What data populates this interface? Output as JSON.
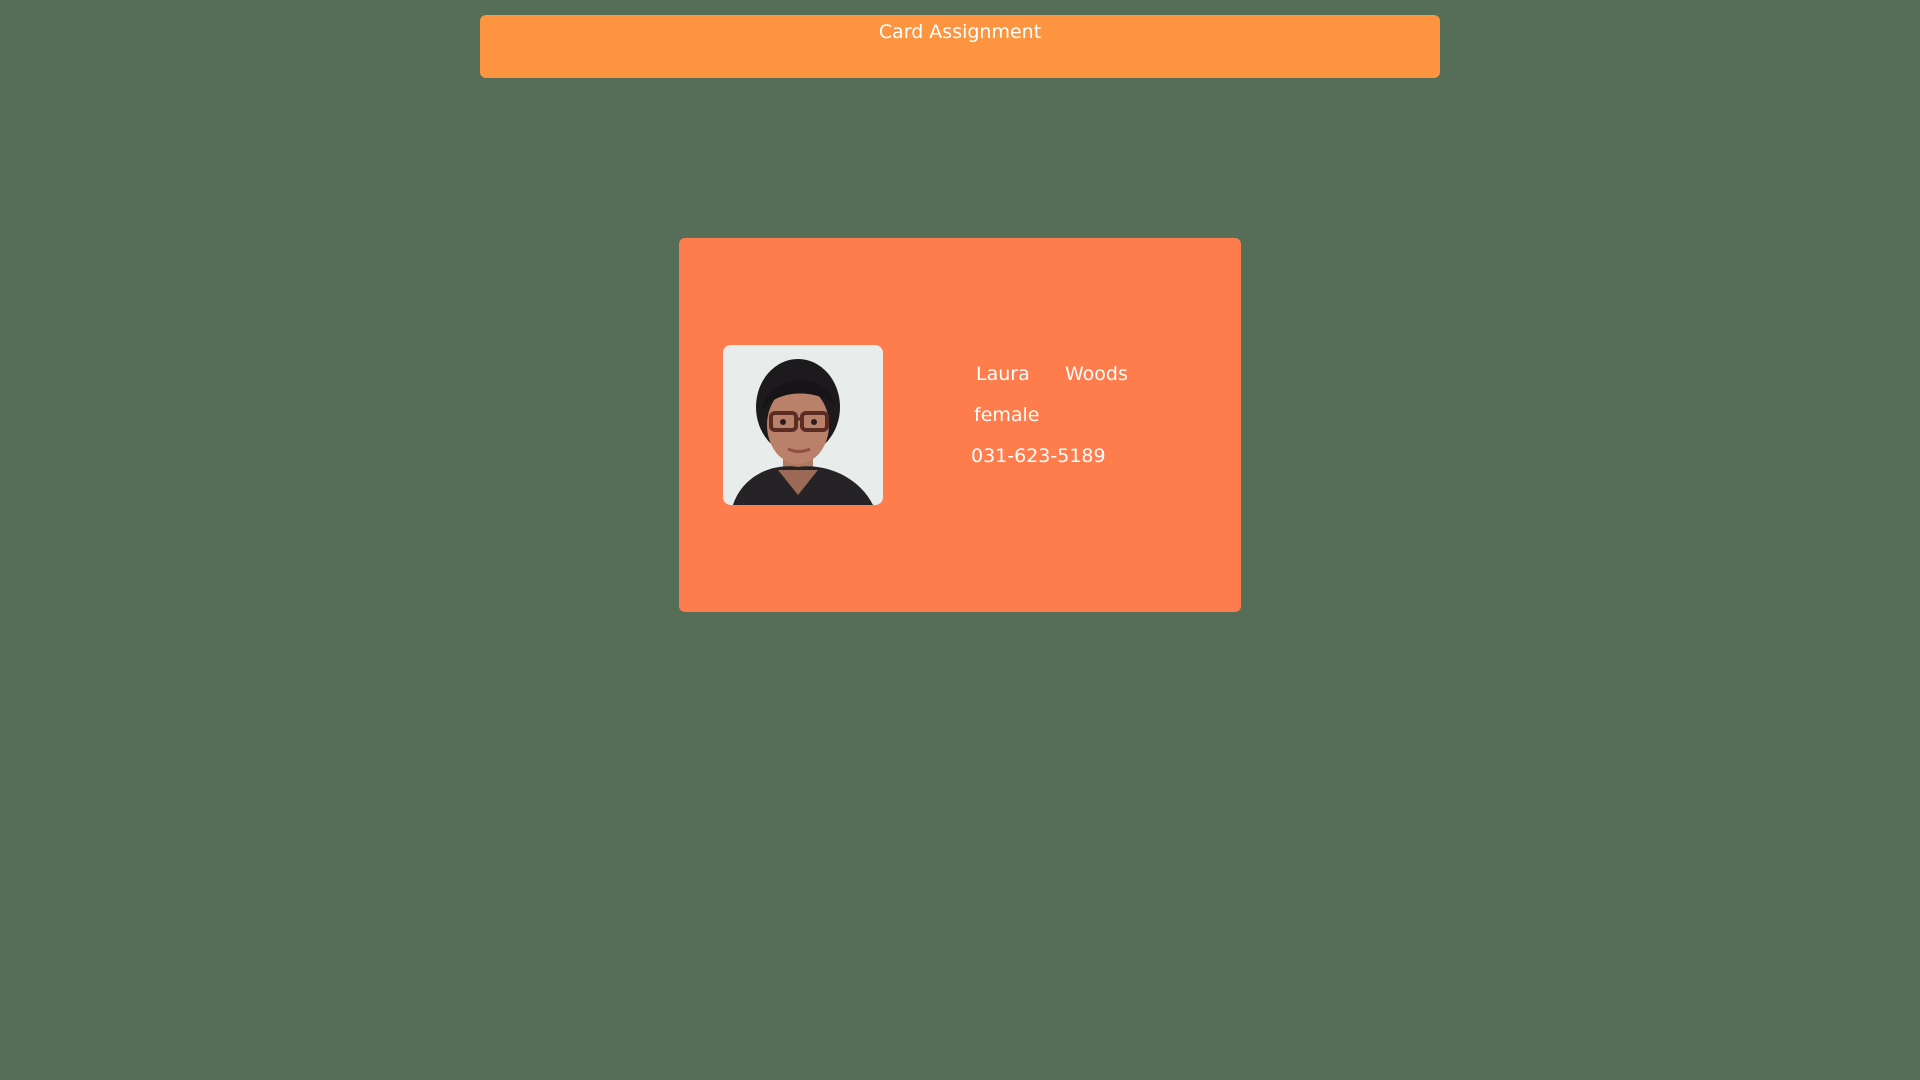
{
  "header": {
    "title": "Card Assignment"
  },
  "card": {
    "avatar": "person-photo-icon",
    "first_name": "Laura",
    "last_name": "Woods",
    "gender": "female",
    "phone": "031-623-5189"
  },
  "colors": {
    "background": "#566d57",
    "header": "#fd943f",
    "card": "#ff7c4d",
    "text": "#ffffff"
  }
}
